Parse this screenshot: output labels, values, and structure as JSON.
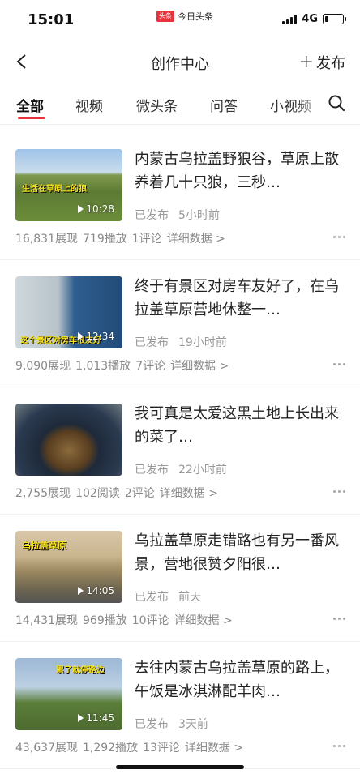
{
  "status_bar": {
    "time": "15:01",
    "app_badge": "头条",
    "app_name": "今日头条",
    "network": "4G",
    "battery_level": 0.2
  },
  "nav": {
    "title": "创作中心",
    "publish_label": "发布"
  },
  "tabs": [
    {
      "label": "全部",
      "active": true
    },
    {
      "label": "视频",
      "active": false
    },
    {
      "label": "微头条",
      "active": false
    },
    {
      "label": "问答",
      "active": false
    },
    {
      "label": "小视频",
      "active": false
    }
  ],
  "items": [
    {
      "title": "内蒙古乌拉盖野狼谷，草原上散养着几十只狼，三秒…",
      "thumb_caption": "生活在草原上的狼",
      "duration": "10:28",
      "status": "已发布",
      "time": "5小时前",
      "impressions": "16,831展现",
      "plays": "719播放",
      "comments": "1评论",
      "detail": "详细数据 >"
    },
    {
      "title": "终于有景区对房车友好了，在乌拉盖草原营地休整一…",
      "thumb_caption": "这个景区对房车很友好",
      "duration": "12:34",
      "status": "已发布",
      "time": "19小时前",
      "impressions": "9,090展现",
      "plays": "1,013播放",
      "comments": "7评论",
      "detail": "详细数据 >"
    },
    {
      "title": "我可真是太爱这黑土地上长出来的菜了…",
      "thumb_caption": "",
      "duration": "",
      "status": "已发布",
      "time": "22小时前",
      "impressions": "2,755展现",
      "plays": "102阅读",
      "comments": "2评论",
      "detail": "详细数据 >"
    },
    {
      "title": "乌拉盖草原走错路也有另一番风景，营地很赞夕阳很…",
      "thumb_caption": "乌拉盖草原",
      "duration": "14:05",
      "status": "已发布",
      "time": "前天",
      "impressions": "14,431展现",
      "plays": "969播放",
      "comments": "10评论",
      "detail": "详细数据 >"
    },
    {
      "title": "去往内蒙古乌拉盖草原的路上，午饭是冰淇淋配羊肉…",
      "thumb_caption": "累了就停路边",
      "duration": "11:45",
      "status": "已发布",
      "time": "3天前",
      "impressions": "43,637展现",
      "plays": "1,292播放",
      "comments": "13评论",
      "detail": "详细数据 >"
    }
  ],
  "colors": {
    "accent": "#e8323c",
    "text": "#222222",
    "muted": "#999999"
  }
}
